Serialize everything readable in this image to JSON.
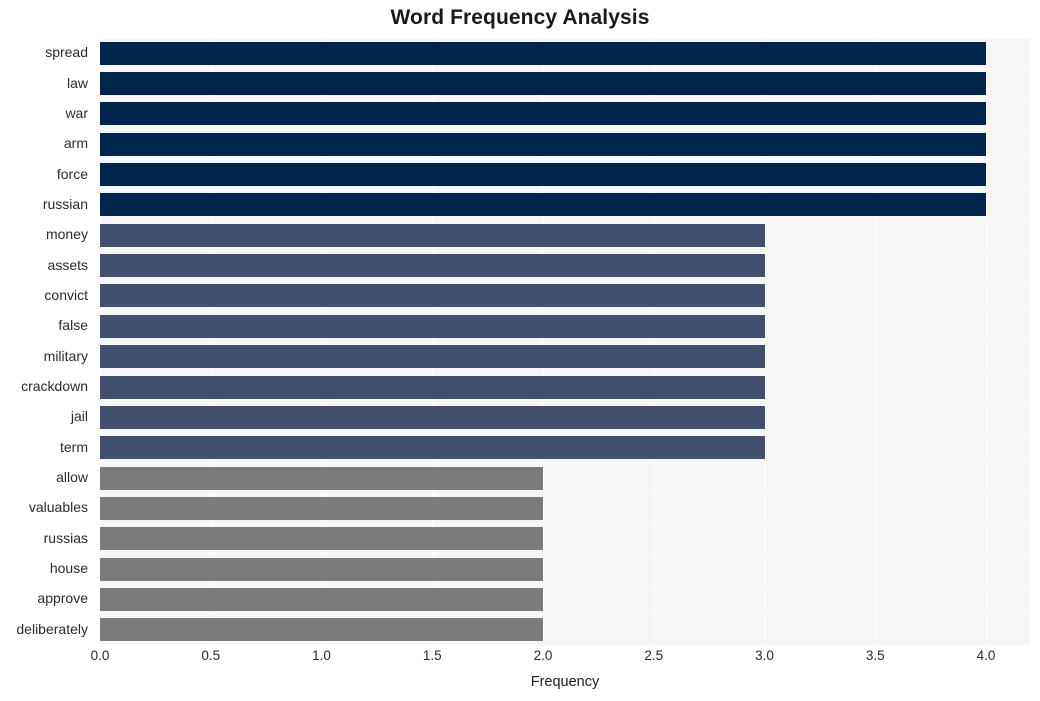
{
  "chart_data": {
    "type": "bar",
    "orientation": "horizontal",
    "title": "Word Frequency Analysis",
    "xlabel": "Frequency",
    "ylabel": "",
    "categories": [
      "spread",
      "law",
      "war",
      "arm",
      "force",
      "russian",
      "money",
      "assets",
      "convict",
      "false",
      "military",
      "crackdown",
      "jail",
      "term",
      "allow",
      "valuables",
      "russias",
      "house",
      "approve",
      "deliberately"
    ],
    "values": [
      4,
      4,
      4,
      4,
      4,
      4,
      3,
      3,
      3,
      3,
      3,
      3,
      3,
      3,
      2,
      2,
      2,
      2,
      2,
      2
    ],
    "bar_colors": [
      "#00254d",
      "#00254d",
      "#00254d",
      "#00254d",
      "#00254d",
      "#00254d",
      "#434f6e",
      "#434f6e",
      "#434f6e",
      "#434f6e",
      "#434f6e",
      "#434f6e",
      "#434f6e",
      "#434f6e",
      "#7b7b7a",
      "#7b7b7a",
      "#7b7b7a",
      "#7b7b7a",
      "#7b7b7a",
      "#7b7b7a"
    ],
    "xlim": [
      0.0,
      4.0
    ],
    "xticks": [
      0.0,
      0.5,
      1.0,
      1.5,
      2.0,
      2.5,
      3.0,
      3.5,
      4.0
    ],
    "xtick_labels": [
      "0.0",
      "0.5",
      "1.0",
      "1.5",
      "2.0",
      "2.5",
      "3.0",
      "3.5",
      "4.0"
    ],
    "grid": true,
    "grid_axis": "both",
    "legend": false,
    "plot_background": "#f6f6f7",
    "figure_background": "#ffffff",
    "gridline_color": "#ffffff",
    "title_color": "#1a1a1a",
    "tick_label_color": "#2b2b2b"
  }
}
